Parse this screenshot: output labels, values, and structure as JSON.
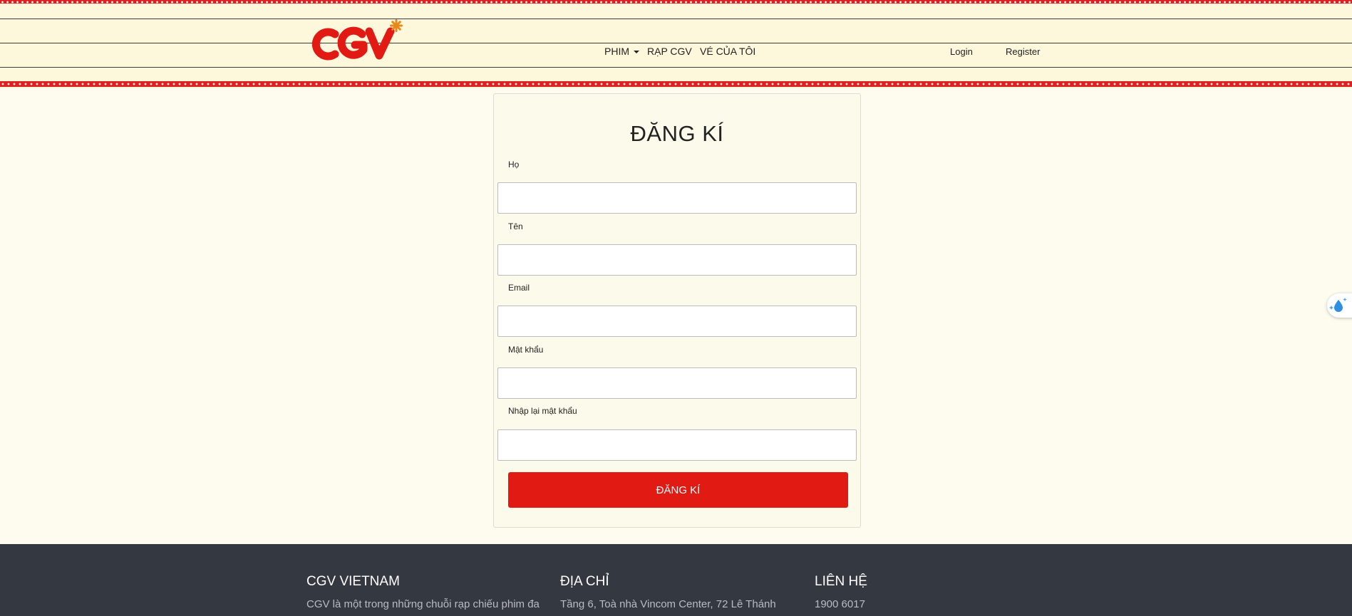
{
  "header": {
    "logo_text": "CGV",
    "nav": {
      "films_label": "PHIM",
      "cinemas_label": "RẠP CGV",
      "my_tickets_label": "VÉ CỦA TÔI"
    },
    "login_label": "Login",
    "register_label": "Register"
  },
  "form": {
    "title": "ĐĂNG KÍ",
    "fields": [
      {
        "label": "Họ",
        "value": "",
        "placeholder": ""
      },
      {
        "label": "Tên",
        "value": "",
        "placeholder": ""
      },
      {
        "label": "Email",
        "value": "",
        "placeholder": ""
      },
      {
        "label": "Mật khẩu",
        "value": "",
        "placeholder": ""
      },
      {
        "label": "Nhập lại mật khẩu",
        "value": "",
        "placeholder": ""
      }
    ],
    "submit_label": "ĐĂNG KÍ"
  },
  "footer": {
    "col1": {
      "heading": "CGV VIETNAM",
      "text": "CGV là một trong những chuỗi rạp chiếu phim đa"
    },
    "col2": {
      "heading": "ĐỊA CHỈ",
      "text": "Tầng 6, Toà nhà Vincom Center, 72 Lê Thánh"
    },
    "col3": {
      "heading": "LIÊN HỆ",
      "text": "1900 6017"
    }
  },
  "icons": {
    "dropdown": "chevron-down-icon",
    "floating_widget": "droplet-sparkle-icon"
  },
  "colors": {
    "brand_red": "#e21a14",
    "header_bg": "#fdf7dc",
    "page_bg": "#fdfcef",
    "footer_bg": "#343840"
  }
}
